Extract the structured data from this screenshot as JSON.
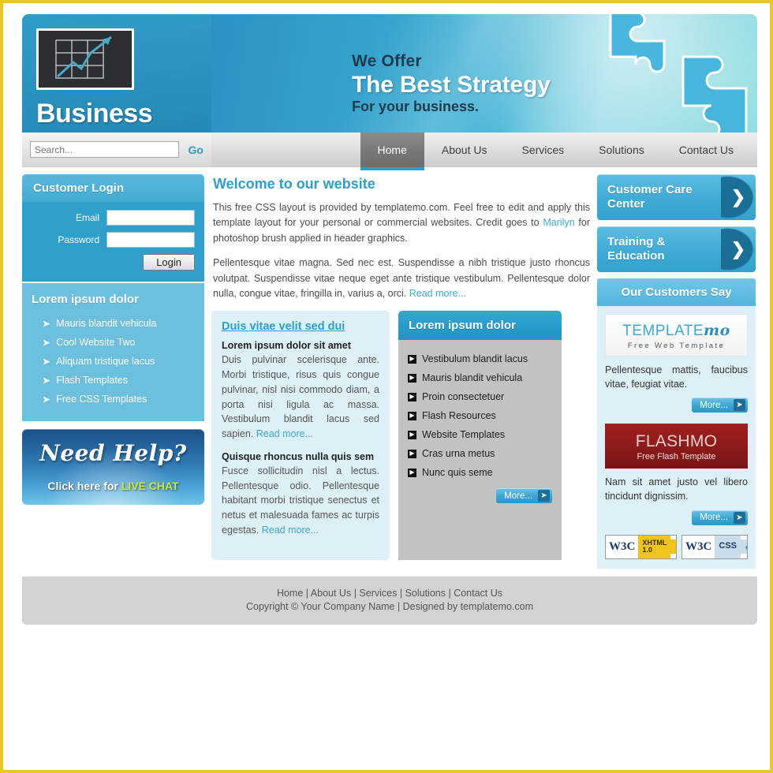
{
  "brand": {
    "logo_title": "Business",
    "logo_icon": "line-chart-icon"
  },
  "banner": {
    "line1": "We Offer",
    "line2": "The Best Strategy",
    "line3": "For your business.",
    "graphic": "puzzle-pieces"
  },
  "search": {
    "placeholder": "Search...",
    "value": "",
    "go_label": "Go"
  },
  "nav": {
    "items": [
      {
        "label": "Home",
        "active": true
      },
      {
        "label": "About Us",
        "active": false
      },
      {
        "label": "Services",
        "active": false
      },
      {
        "label": "Solutions",
        "active": false
      },
      {
        "label": "Contact Us",
        "active": false
      }
    ]
  },
  "login": {
    "title": "Customer Login",
    "email_label": "Email",
    "email_value": "",
    "password_label": "Password",
    "password_value": "",
    "button_label": "Login"
  },
  "side_list": {
    "title": "Lorem ipsum dolor",
    "items": [
      "Mauris blandit vehicula",
      "Cool Website Two",
      "Aliquam tristique lacus",
      "Flash Templates",
      "Free CSS Templates"
    ]
  },
  "help_banner": {
    "script_text": "Need Help?",
    "sub_prefix": "Click here for ",
    "sub_highlight": "LIVE CHAT"
  },
  "welcome": {
    "heading": "Welcome to our website",
    "p1_a": "This free CSS layout is provided by templatemo.com. Feel free to edit and apply this template layout for your personal or commercial websites. Credit goes to ",
    "p1_link": "Marilyn",
    "p1_b": " for photoshop brush applied in header graphics.",
    "p2_a": "Pellentesque vitae magna. Sed nec est. Suspendisse a nibh tristique justo rhoncus volutpat. Suspendisse vitae neque eget ante tristique vestibulum. Pellentesque dolor nulla, congue vitae, fringilla in, varius a, orci. ",
    "p2_link": "Read more..."
  },
  "box_a": {
    "title": "Duis vitae velit sed dui",
    "sub1": "Lorem ipsum dolor sit amet",
    "body1": "Duis pulvinar scelerisque ante. Morbi tristique, risus quis congue pulvinar, nisl nisi commodo diam, a porta nisi ligula ac massa. Vestibulum blandit lacus sed sapien. ",
    "link1": "Read more...",
    "sub2": "Quisque rhoncus nulla quis sem",
    "body2": "Fusce sollicitudin nisl a lectus. Pellentesque odio. Pellentesque habitant morbi tristique senectus et netus et malesuada fames ac turpis egestas. ",
    "link2": "Read more..."
  },
  "box_b": {
    "title": "Lorem ipsum dolor",
    "items": [
      "Vestibulum blandit lacus",
      "Mauris blandit vehicula",
      "Proin consectetuer",
      "Flash Resources",
      "Website Templates",
      "Cras urna metus",
      "Nunc quis seme"
    ],
    "more_label": "More..."
  },
  "cta": [
    {
      "label": "Customer Care Center",
      "icon": "chevron-right-icon"
    },
    {
      "label": "Training & Education",
      "icon": "chevron-right-icon"
    }
  ],
  "customers": {
    "heading": "Our Customers Say",
    "items": [
      {
        "logo_main": "TEMPLATE",
        "logo_accent": "mo",
        "logo_tagline": "Free Web Template",
        "quote": "Pellentesque mattis, faucibus vitae, feugiat vitae.",
        "more_label": "More..."
      },
      {
        "logo_main": "FLASH",
        "logo_accent": "MO",
        "logo_tagline": "Free Flash Template",
        "quote": "Nam sit amet justo vel libero tincidunt dignissim.",
        "more_label": "More..."
      }
    ]
  },
  "badges": [
    {
      "mark": "W3C",
      "tag_line1": "XHTML",
      "tag_line2": "1.0",
      "check": "✔"
    },
    {
      "mark": "W3C",
      "tag_line1": "CSS",
      "tag_line2": "",
      "check": "✔"
    }
  ],
  "footer": {
    "links": [
      "Home",
      "About Us",
      "Services",
      "Solutions",
      "Contact Us"
    ],
    "separator": " | ",
    "copyright": "Copyright © Your Company Name | Designed by templatemo.com"
  },
  "colors": {
    "frame": "#e8c72e",
    "accent": "#2f9dc9",
    "light_blue": "#6cc0de",
    "pale_blue": "#ddf0f8",
    "gray": "#c2c2c2",
    "red": "#8c1a1a",
    "highlight": "#cde83c"
  }
}
